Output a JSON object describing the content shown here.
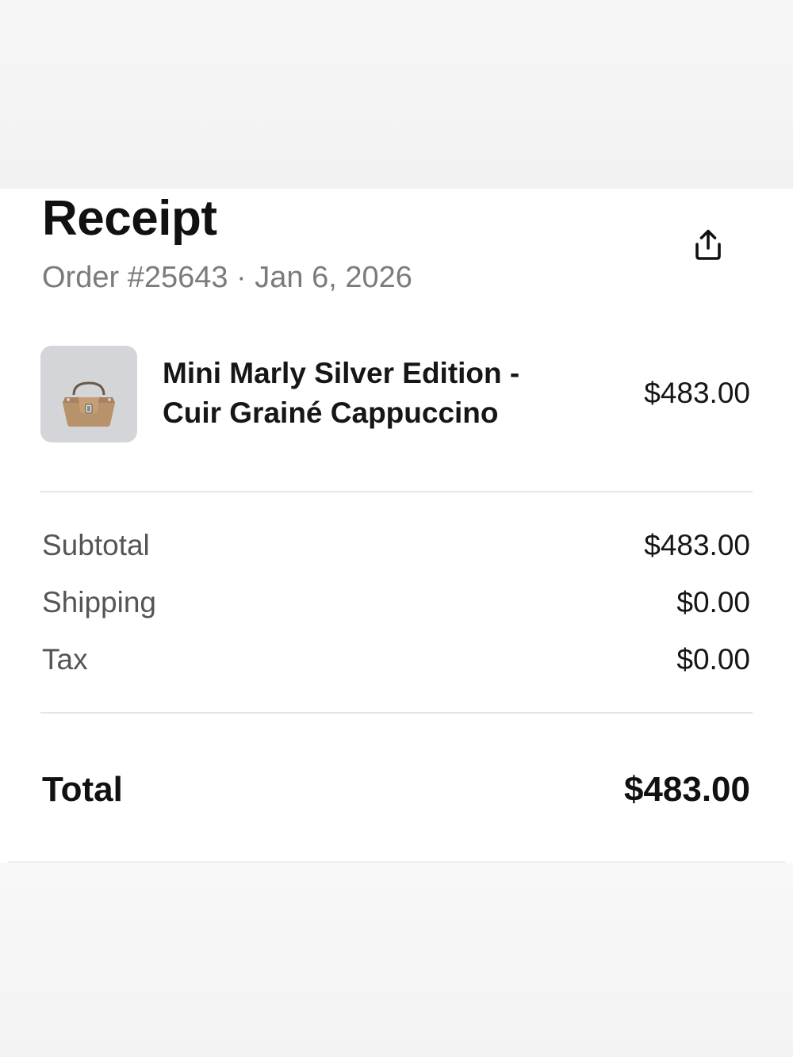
{
  "receipt": {
    "title": "Receipt",
    "order_meta": "Order #25643 · Jan 6, 2026",
    "share_icon": "share-icon"
  },
  "item": {
    "name": "Mini Marly Silver Edition - Cuir Grainé Cappuccino",
    "price": "$483.00",
    "thumbnail_icon": "handbag-image"
  },
  "summary": {
    "subtotal_label": "Subtotal",
    "subtotal_value": "$483.00",
    "shipping_label": "Shipping",
    "shipping_value": "$0.00",
    "tax_label": "Tax",
    "tax_value": "$0.00"
  },
  "total": {
    "label": "Total",
    "value": "$483.00"
  },
  "colors": {
    "text_primary": "#111111",
    "text_secondary": "#7b7b7b",
    "divider": "#e6e6e6",
    "thumbnail_bg": "#d4d5d8",
    "bag_leather": "#b8926a"
  }
}
